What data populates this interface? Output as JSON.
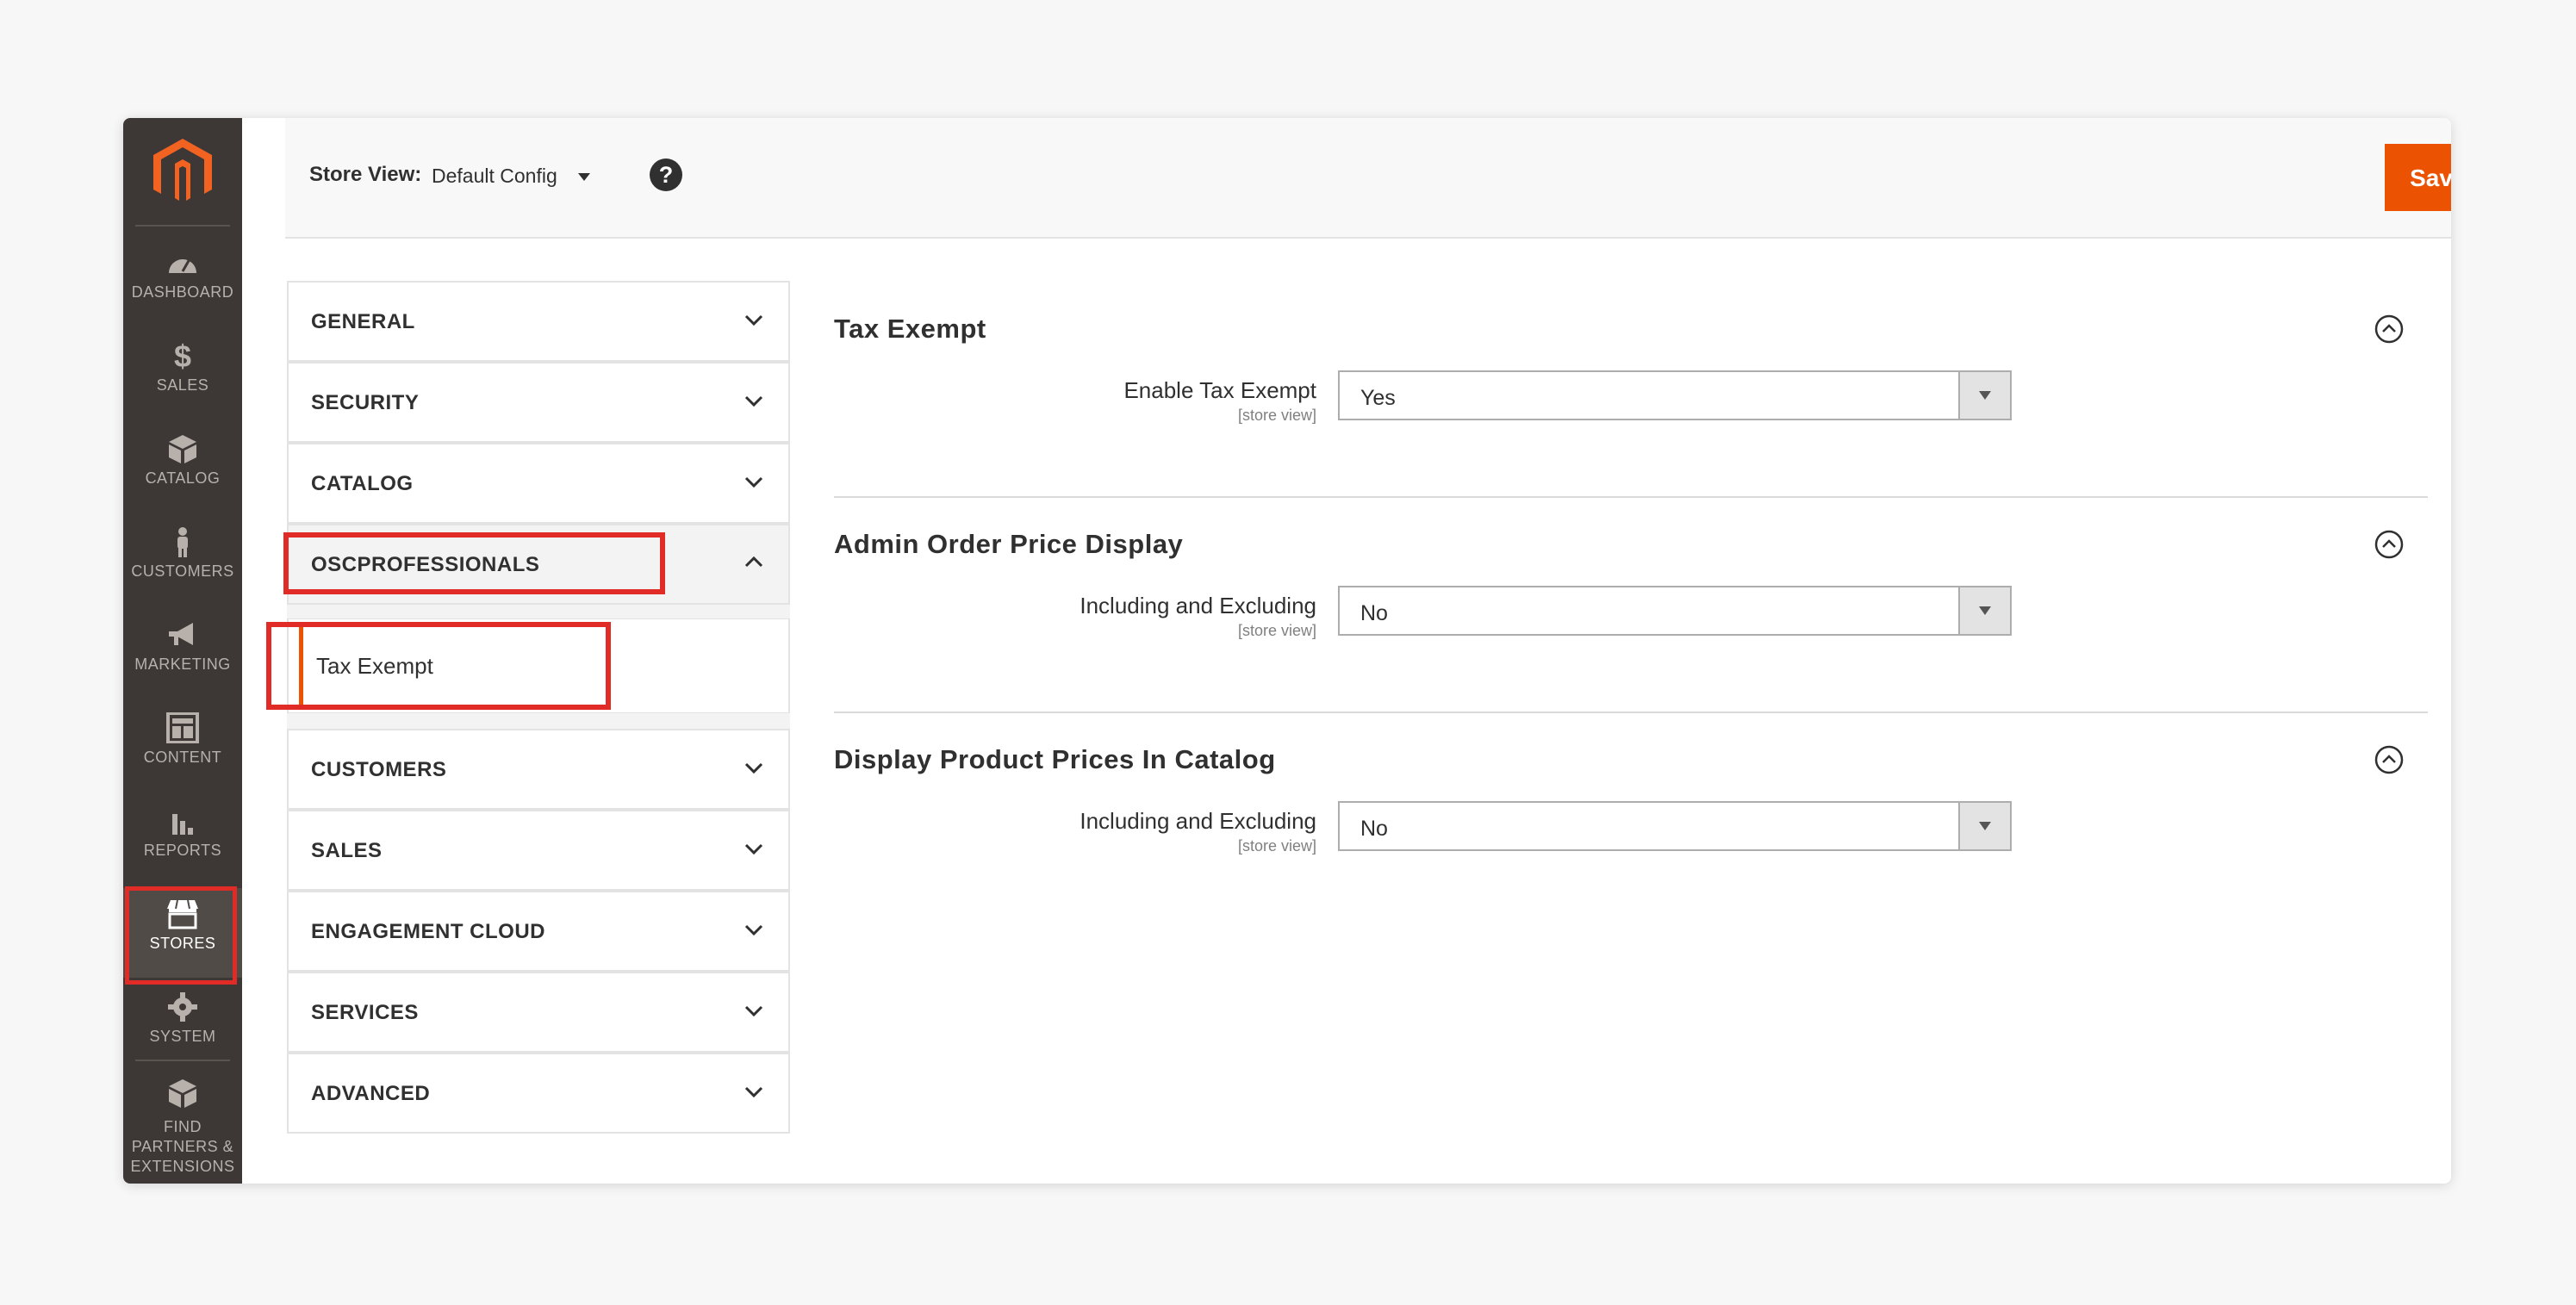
{
  "sidebar": {
    "items": [
      {
        "label": "DASHBOARD",
        "icon": "dashboard-icon"
      },
      {
        "label": "SALES",
        "icon": "dollar-icon"
      },
      {
        "label": "CATALOG",
        "icon": "box-icon"
      },
      {
        "label": "CUSTOMERS",
        "icon": "person-icon"
      },
      {
        "label": "MARKETING",
        "icon": "megaphone-icon"
      },
      {
        "label": "CONTENT",
        "icon": "layout-icon"
      },
      {
        "label": "REPORTS",
        "icon": "bar-chart-icon"
      },
      {
        "label": "STORES",
        "icon": "storefront-icon"
      },
      {
        "label": "SYSTEM",
        "icon": "gear-icon"
      }
    ],
    "partners": {
      "line1": "FIND",
      "line2": "PARTNERS &",
      "line3": "EXTENSIONS"
    }
  },
  "topbar": {
    "store_view_label": "Store View:",
    "store_view_value": "Default Config",
    "help": "?",
    "save_label": "Save Config"
  },
  "config_nav": {
    "items": [
      "GENERAL",
      "SECURITY",
      "CATALOG",
      "OSCPROFESSIONALS",
      "CUSTOMERS",
      "SALES",
      "ENGAGEMENT CLOUD",
      "SERVICES",
      "ADVANCED"
    ],
    "sub_item": "Tax Exempt"
  },
  "sections": [
    {
      "title": "Tax Exempt",
      "field_label": "Enable Tax Exempt",
      "scope": "[store view]",
      "value": "Yes"
    },
    {
      "title": "Admin Order Price Display",
      "field_label": "Including and Excluding",
      "scope": "[store view]",
      "value": "No"
    },
    {
      "title": "Display Product Prices In Catalog",
      "field_label": "Including and Excluding",
      "scope": "[store view]",
      "value": "No"
    }
  ],
  "colors": {
    "accent": "#eb5202",
    "highlight": "#e02b27",
    "sidebar": "#3d3836"
  }
}
